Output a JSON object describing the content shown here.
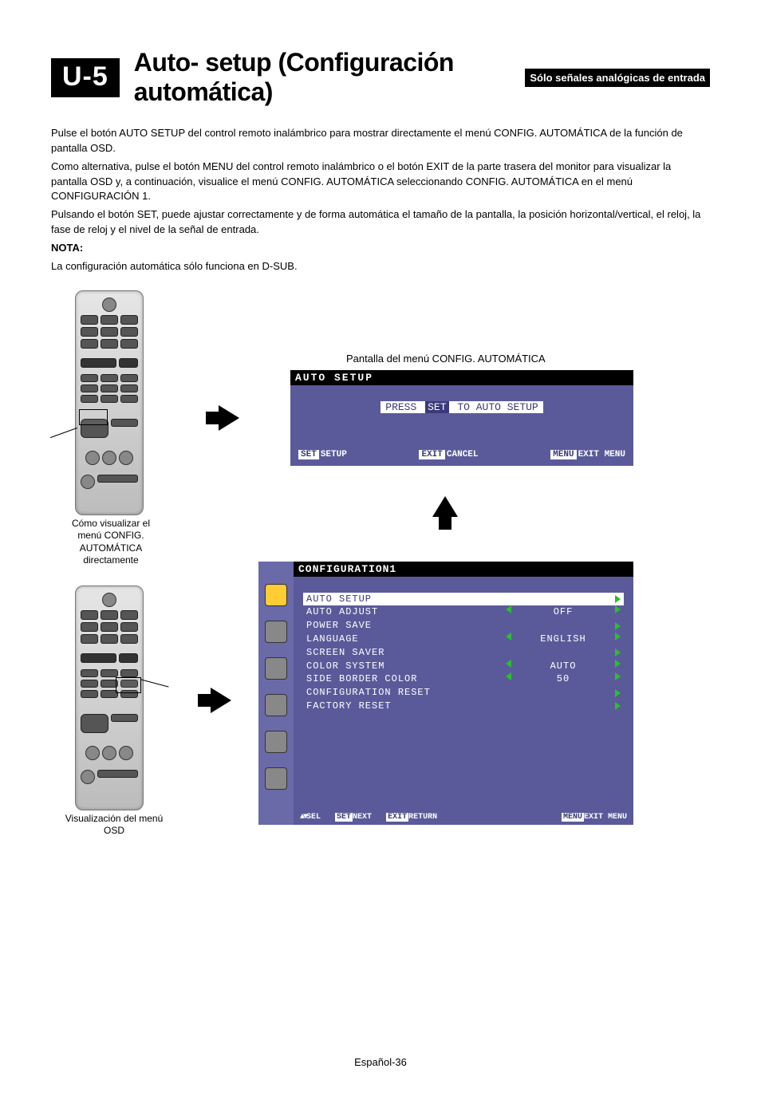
{
  "header": {
    "badge": "U-5",
    "title": "Auto- setup (Configuración automática)",
    "sub_badge": "Sólo señales analógicas de entrada"
  },
  "body": {
    "p1": "Pulse el botón AUTO SETUP del control remoto inalámbrico para mostrar directamente el menú CONFIG. AUTOMÁTICA de la función de pantalla OSD.",
    "p2": "Como alternativa, pulse el botón MENU del control remoto inalámbrico o el botón EXIT de la parte trasera del monitor para visualizar la pantalla OSD y, a continuación, visualice el menú CONFIG. AUTOMÁTICA seleccionando CONFIG. AUTOMÁTICA en el menú CONFIGURACIÓN 1.",
    "p3": "Pulsando el botón SET, puede ajustar correctamente y de forma automática el tamaño de la pantalla, la posición horizontal/vertical, el reloj, la fase de reloj y el nivel de la señal de entrada.",
    "nota_label": "NOTA:",
    "nota_text": "La configuración automática sólo funciona en D-SUB."
  },
  "captions": {
    "remote1": "Cómo visualizar el menú CONFIG. AUTOMÁTICA directamente",
    "remote2": "Visualización del menú OSD",
    "osd1_caption": "Pantalla del menú CONFIG. AUTOMÁTICA"
  },
  "osd1": {
    "title": "AUTO SETUP",
    "press_prefix": "PRESS",
    "press_tag": "SET",
    "press_suffix": "TO AUTO SETUP",
    "footer": {
      "set_tag": "SET",
      "set_label": "SETUP",
      "exit_tag": "EXIT",
      "exit_label": "CANCEL",
      "menu_tag": "MENU",
      "menu_label": "EXIT MENU"
    }
  },
  "osd2": {
    "title": "CONFIGURATION1",
    "rows": [
      {
        "label": "AUTO SETUP",
        "left": false,
        "right": true,
        "value": "",
        "hl": true
      },
      {
        "label": "AUTO ADJUST",
        "left": true,
        "right": true,
        "value": "OFF",
        "hl": false
      },
      {
        "label": "POWER SAVE",
        "left": false,
        "right": true,
        "value": "",
        "hl": false
      },
      {
        "label": "LANGUAGE",
        "left": true,
        "right": true,
        "value": "ENGLISH",
        "hl": false
      },
      {
        "label": "SCREEN SAVER",
        "left": false,
        "right": true,
        "value": "",
        "hl": false
      },
      {
        "label": "COLOR SYSTEM",
        "left": true,
        "right": true,
        "value": "AUTO",
        "hl": false
      },
      {
        "label": "SIDE BORDER COLOR",
        "left": true,
        "right": true,
        "value": "50",
        "hl": false
      },
      {
        "label": "CONFIGURATION RESET",
        "left": false,
        "right": true,
        "value": "",
        "hl": false
      },
      {
        "label": "FACTORY RESET",
        "left": false,
        "right": true,
        "value": "",
        "hl": false
      }
    ],
    "footer": {
      "sel_label": "SEL",
      "set_tag": "SET",
      "set_label": "NEXT",
      "exit_tag": "EXIT",
      "exit_label": "RETURN",
      "menu_tag": "MENU",
      "menu_label": "EXIT MENU"
    }
  },
  "footer": {
    "page_label": "Español-36"
  }
}
